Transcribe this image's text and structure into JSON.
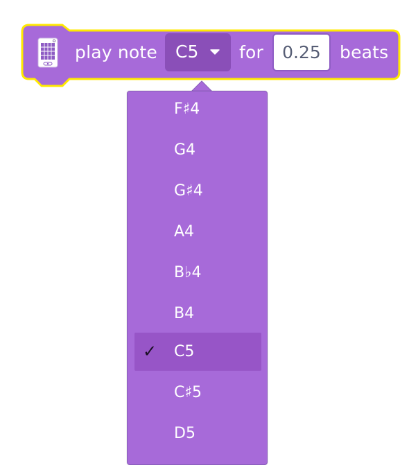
{
  "block": {
    "text_play_note": "play note",
    "text_for": "for",
    "text_beats": "beats",
    "note_value": "C5",
    "beats_value": "0.25",
    "icon": "sound-board-icon",
    "colors": {
      "block_fill": "#a76ad9",
      "block_outline": "#ffe900",
      "dropdown_fill": "#8a4fb8",
      "input_fill": "#ffffff",
      "input_text": "#575e75"
    }
  },
  "menu": {
    "items": [
      {
        "label": "F♯4",
        "selected": false
      },
      {
        "label": "G4",
        "selected": false
      },
      {
        "label": "G♯4",
        "selected": false
      },
      {
        "label": "A4",
        "selected": false
      },
      {
        "label": "B♭4",
        "selected": false
      },
      {
        "label": "B4",
        "selected": false
      },
      {
        "label": "C5",
        "selected": true
      },
      {
        "label": "C♯5",
        "selected": false
      },
      {
        "label": "D5",
        "selected": false
      }
    ],
    "check_mark": "✓",
    "colors": {
      "menu_fill": "#a76ad9",
      "selected_fill": "#9755c7"
    }
  }
}
